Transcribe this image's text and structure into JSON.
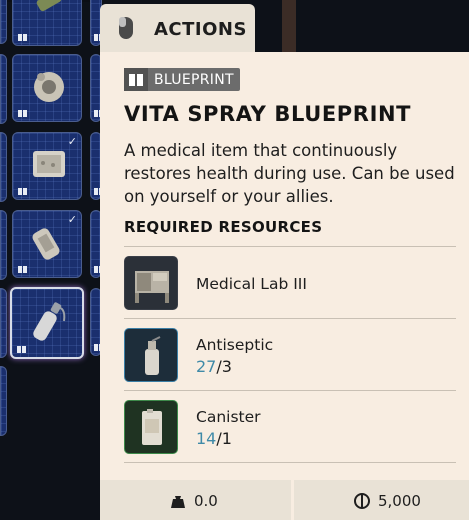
{
  "tab": {
    "label": "ACTIONS",
    "icon": "mouse-icon"
  },
  "badge": {
    "label": "BLUEPRINT",
    "icon": "book-icon"
  },
  "item": {
    "title": "VITA SPRAY BLUEPRINT",
    "description": "A medical item that continuously restores health during use. Can be used on yourself or your allies."
  },
  "requirements": {
    "label": "REQUIRED RESOURCES",
    "items": [
      {
        "name": "Medical Lab III",
        "icon": "medical-lab-icon"
      },
      {
        "name": "Antiseptic",
        "have": "27",
        "need": "/3",
        "icon": "antiseptic-bottle-icon"
      },
      {
        "name": "Canister",
        "have": "14",
        "need": "/1",
        "icon": "canister-icon"
      }
    ]
  },
  "footer": {
    "weight": {
      "value": "0.0",
      "icon": "weight-icon"
    },
    "price": {
      "value": "5,000",
      "icon": "coin-icon"
    }
  },
  "colors": {
    "panel": "#f8ede1",
    "tab": "#e9e2d6",
    "count_have": "#3f8aa8",
    "slot": "#1a2f6e"
  }
}
